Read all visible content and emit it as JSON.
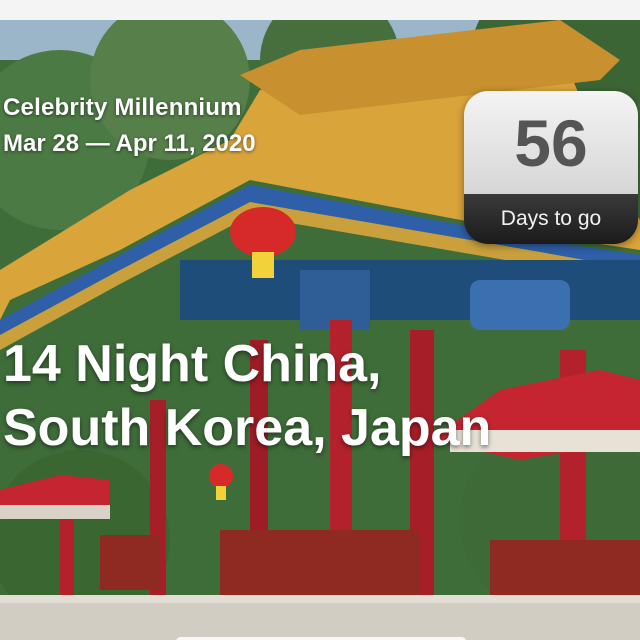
{
  "trip": {
    "ship_name": "Celebrity Millennium",
    "date_range": "Mar 28 — Apr 11, 2020",
    "title_line1": "14 Night China,",
    "title_line2": "South Korea, Japan"
  },
  "countdown": {
    "number": "56",
    "label": "Days to go"
  },
  "photo": {
    "subject": "Chinese pavilion with red lantern"
  },
  "colors": {
    "roof_gold": "#d9a43a",
    "beam_blue": "#2e5fa8",
    "pillar_red": "#b3222c",
    "foliage": "#3f6d3a",
    "sky": "#9bb6c9"
  }
}
